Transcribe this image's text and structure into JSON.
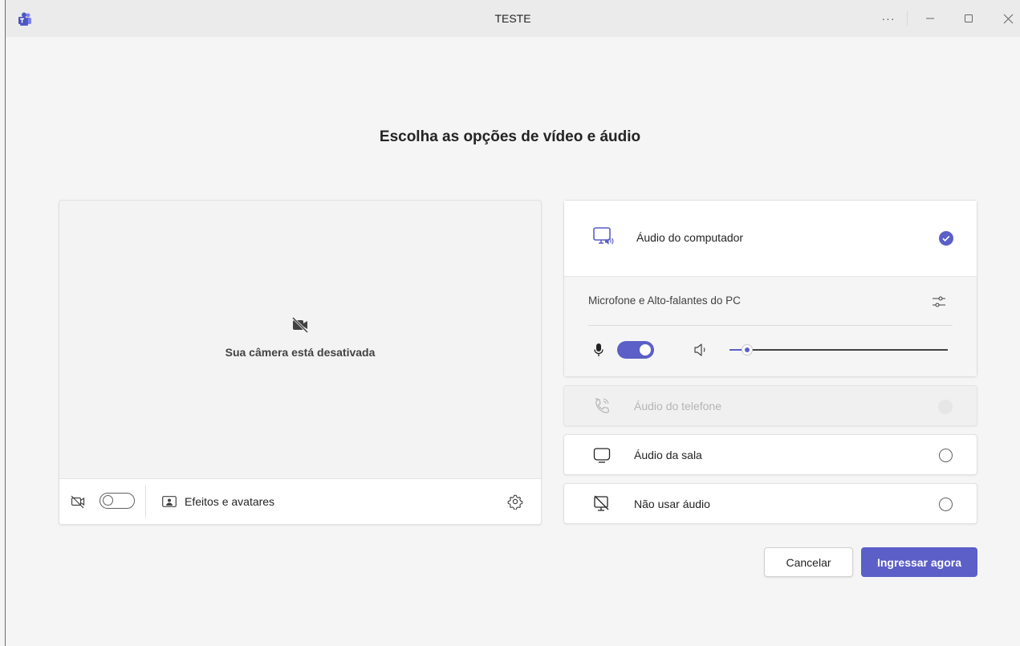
{
  "window": {
    "title": "TESTE",
    "app_icon": "teams-icon",
    "controls": {
      "more": "···",
      "minimize": "minimize-icon",
      "maximize": "maximize-icon",
      "close": "close-icon"
    }
  },
  "heading": "Escolha as opções de vídeo e áudio",
  "video": {
    "camera_off_icon": "camera-off-icon",
    "camera_off_text": "Sua câmera está desativada",
    "camera_toggle_on": false,
    "effects_label": "Efeitos e avatares",
    "settings_icon": "gear-icon"
  },
  "audio": {
    "options": {
      "computer": {
        "label": "Áudio do computador",
        "selected": true
      },
      "phone": {
        "label": "Áudio do telefone",
        "disabled": true
      },
      "room": {
        "label": "Áudio da sala",
        "selected": false
      },
      "none": {
        "label": "Não usar áudio",
        "selected": false
      }
    },
    "device_label": "Microfone e Alto-falantes do PC",
    "mic_on": true,
    "speaker_volume": 0.08
  },
  "actions": {
    "cancel_label": "Cancelar",
    "join_label": "Ingressar agora"
  },
  "colors": {
    "accent": "#5b5fc7",
    "background": "#f5f5f5"
  }
}
